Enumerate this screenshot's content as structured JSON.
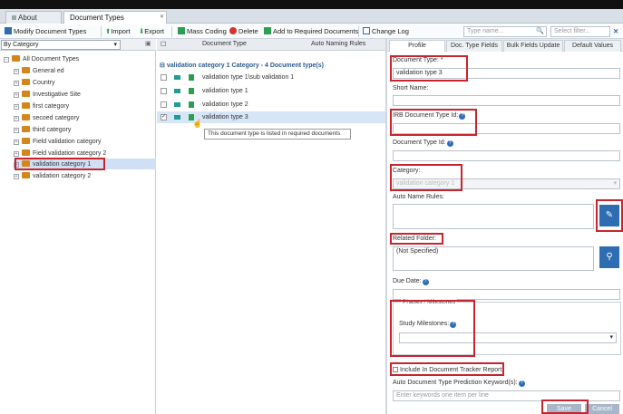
{
  "tabs": [
    {
      "label": "About"
    },
    {
      "label": "Document Types Management"
    }
  ],
  "toolbar": {
    "modify_label": "Modify Document Types",
    "import_label": "Import",
    "export_label": "Export",
    "mass_coding_label": "Mass Coding",
    "delete_label": "Delete",
    "add_required_label": "Add to Required Documents",
    "change_log_label": "Change Log",
    "search_placeholder": "Type name...",
    "filter_placeholder": "Select filter..."
  },
  "left": {
    "category_select": "By Category",
    "tree": [
      {
        "label": "All Document Types"
      },
      {
        "label": "General ed"
      },
      {
        "label": "Country"
      },
      {
        "label": "Investigative Site"
      },
      {
        "label": "first category"
      },
      {
        "label": "secoed category"
      },
      {
        "label": "third category"
      },
      {
        "label": "Field validation category"
      },
      {
        "label": "Field validation category 2"
      },
      {
        "label": "validation category 1"
      },
      {
        "label": "validation category 2"
      }
    ]
  },
  "grid": {
    "col_doc_type": "Document Type",
    "col_auto_naming": "Auto Naming Rules",
    "group_label": "validation category 1 Category - 4 Document type(s)",
    "rows": [
      {
        "label": "validation type 1\\sub validation 1"
      },
      {
        "label": "validation type 1"
      },
      {
        "label": "validation type 2"
      },
      {
        "label": "validation type 3"
      }
    ],
    "tooltip": "This document type is listed in required documents"
  },
  "right_tabs": [
    {
      "label": "Profile"
    },
    {
      "label": "Doc. Type Fields"
    },
    {
      "label": "Bulk Fields Update"
    },
    {
      "label": "Default Values"
    }
  ],
  "form": {
    "document_type_label": "Document Type: *",
    "document_type_value": "validation type 3",
    "short_name_label": "Short Name:",
    "irb_label": "IRB Document Type Id:",
    "doc_type_id_label": "Document Type Id:",
    "category_label": "Category:",
    "category_value": "validation category 1",
    "auto_name_rules_label": "Auto Name Rules:",
    "related_folder_label": "Related Folder:",
    "related_folder_value": "(Not Specified)",
    "due_date_label": "Due Date:",
    "phases_legend": "Phases / Milestones",
    "study_milestones_label": "Study Milestones:",
    "include_tracker_label": "Include In Document Tracker Report",
    "auto_keywords_label": "Auto Document Type Prediction Keyword(s):",
    "keywords_placeholder": "Enter keywords one item per line",
    "save_label": "Save",
    "cancel_label": "Cancel"
  },
  "colors": {
    "highlight_red": "#c8242d",
    "folder_orange": "#d4861d",
    "accent_blue": "#2e6db1",
    "tag_teal": "#1f9a94",
    "doc_green": "#2c9e52"
  }
}
